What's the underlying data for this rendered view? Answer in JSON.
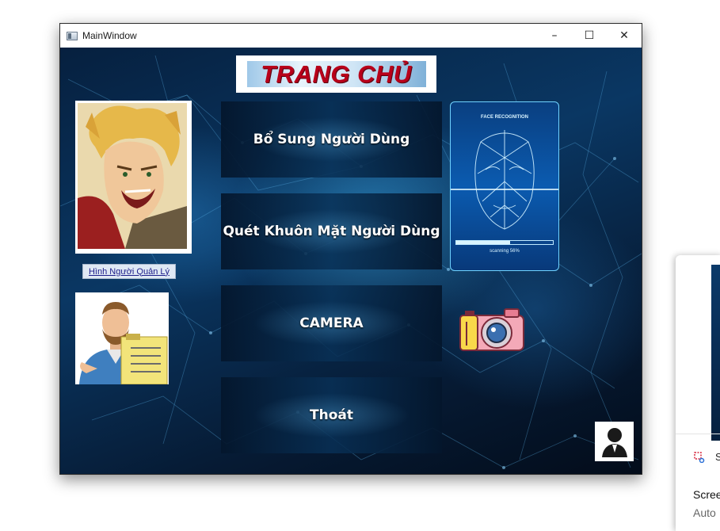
{
  "window": {
    "title": "MainWindow",
    "controls": {
      "minimize": "–",
      "maximize": "☐",
      "close": "✕"
    }
  },
  "page": {
    "title": "TRANG CHỦ",
    "admin_label": "Hình Người Quản Lý",
    "menu": [
      {
        "label": "Bổ Sung Người Dùng"
      },
      {
        "label": "Quét Khuôn Mặt Người Dùng"
      },
      {
        "label": "CAMERA"
      },
      {
        "label": "Thoát"
      }
    ]
  },
  "face_card": {
    "title": "FACE RECOGNITION",
    "scan_text": "scanning 56%",
    "scan_progress": 0.56
  },
  "icons": {
    "app": "window-icon",
    "admin_photo": "admin-photo",
    "manager": "manager-clipart",
    "camera": "camera-icon",
    "user": "user-icon",
    "snip": "snipping-tool-icon"
  },
  "notification": {
    "app": "S",
    "title": "Scree",
    "subtitle": "Auto"
  },
  "colors": {
    "title_red": "#b8001a",
    "background_dark_blue": "#06203f",
    "accent_cyan": "#6fd2ff"
  }
}
